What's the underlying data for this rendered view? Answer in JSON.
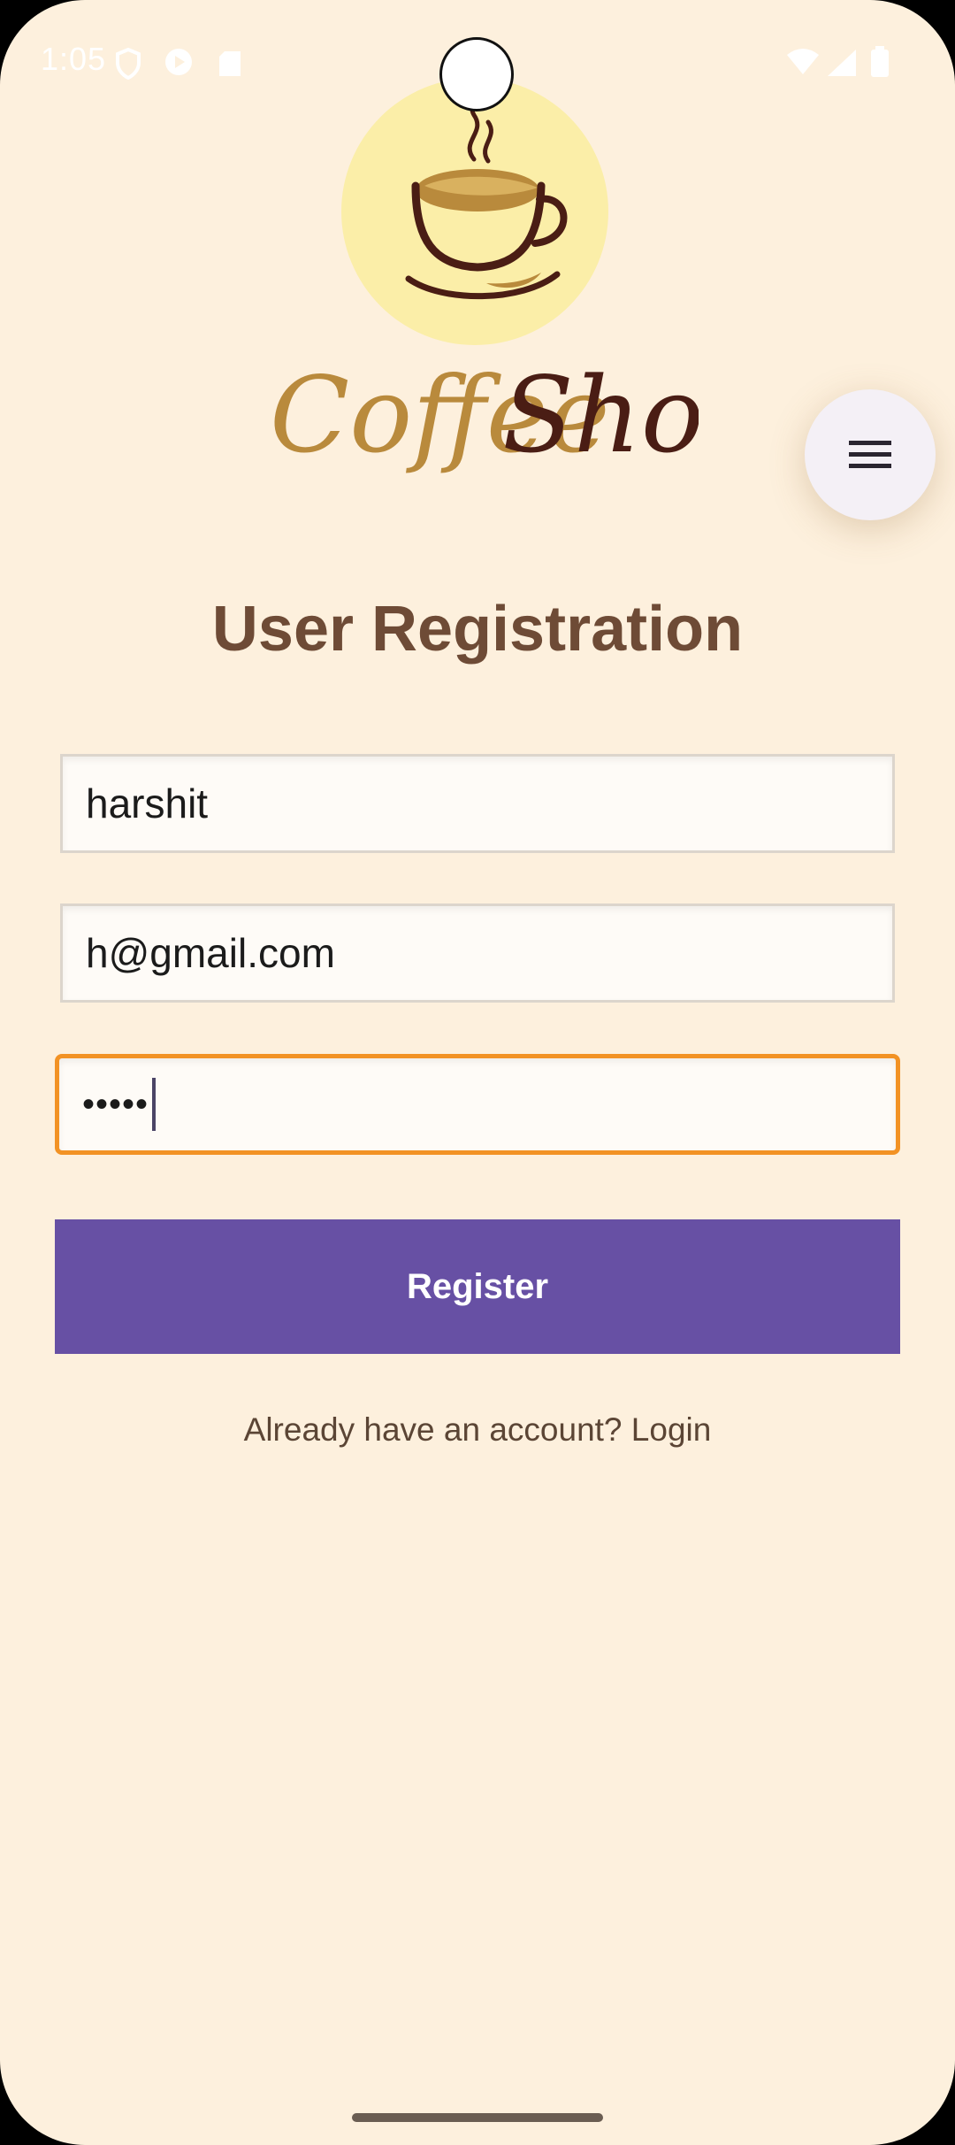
{
  "status_bar": {
    "time": "1:05"
  },
  "brand": {
    "name_part1": "Coffee",
    "name_part2": "Shop",
    "color_light": "#b98a3c",
    "color_dark": "#4a1d14"
  },
  "menu": {
    "icon": "hamburger-menu-icon"
  },
  "form": {
    "title": "User Registration",
    "name_value": "harshit",
    "email_value": "h@gmail.com",
    "password_mask": "•••••",
    "register_label": "Register",
    "login_prompt": "Already have an account? Login"
  },
  "colors": {
    "background": "#fdf0dd",
    "title": "#6e4b36",
    "primary_button": "#6750a4",
    "focus_border": "#f29224"
  }
}
